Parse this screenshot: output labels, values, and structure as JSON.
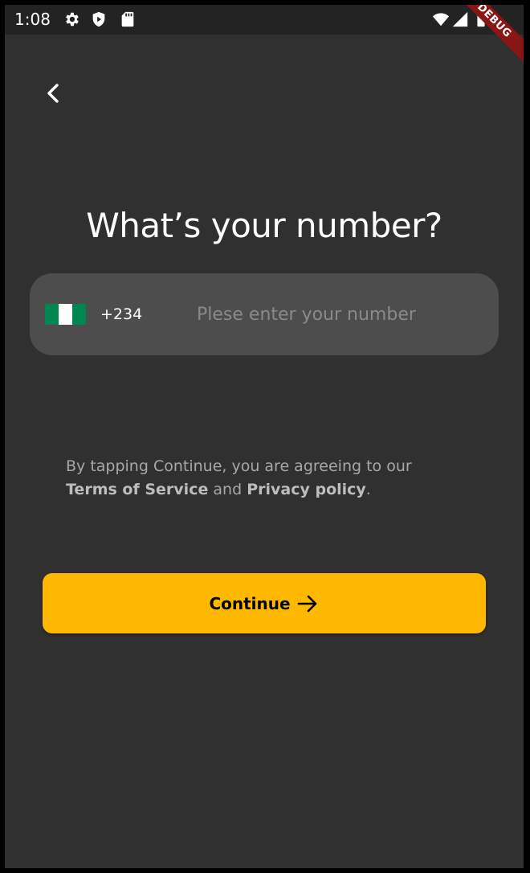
{
  "status_bar": {
    "time": "1:08",
    "icons": [
      "gear-icon",
      "shield-play-icon",
      "sd-card-icon",
      "wifi-icon",
      "cellular-signal-icon",
      "battery-icon"
    ],
    "debug_label": "DEBUG"
  },
  "header": {
    "back_icon": "chevron-left-icon"
  },
  "main": {
    "title": "What’s your number?",
    "phone_field": {
      "country_flag": "nigeria-flag",
      "country_code": "+234",
      "value": "",
      "placeholder": "Plese enter your number"
    },
    "terms": {
      "prefix": "By tapping Continue, you are agreeing to our",
      "terms_link": "Terms of Service",
      "conjunction": "and",
      "privacy_link": "Privacy policy",
      "suffix": "."
    },
    "continue_button": {
      "label": "Continue",
      "icon": "arrow-right-icon"
    }
  },
  "colors": {
    "background": "#303030",
    "status_bar": "#232323",
    "field_background": "#4d4d4d",
    "accent": "#ffb800",
    "flag_green": "#008751",
    "flag_white": "#ffffff",
    "debug_banner": "#8a1515"
  }
}
